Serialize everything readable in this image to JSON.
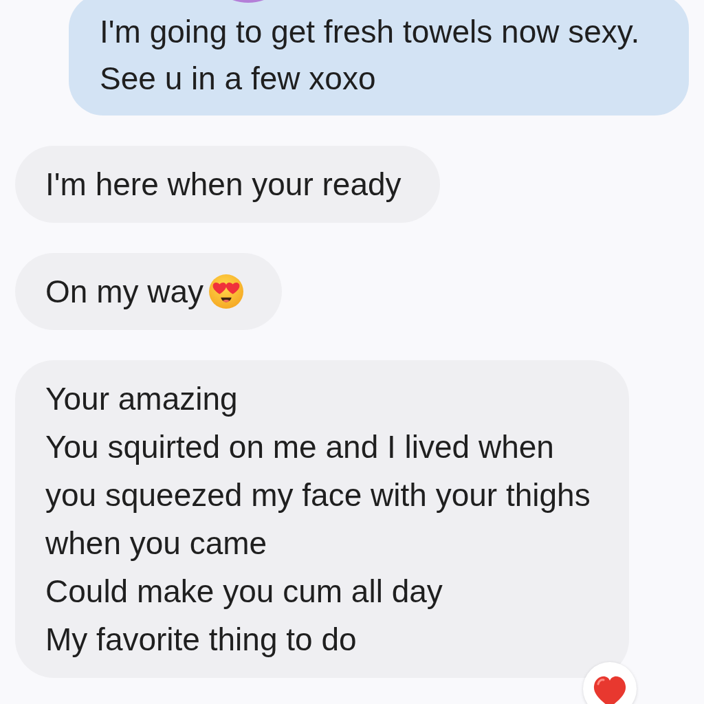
{
  "messages": [
    {
      "kind": "sent",
      "text": "I'm going to get fresh towels now sexy.\nSee u in a few xoxo"
    },
    {
      "kind": "received",
      "text": "I'm here when your ready"
    },
    {
      "kind": "received",
      "text": "On my way",
      "emoji": true
    },
    {
      "kind": "received",
      "text": "Your amazing\nYou squirted on me and I lived when\nyou squeezed my face with your thighs\nwhen you came\nCould make you cum all day\nMy favorite thing to do",
      "reaction": true
    }
  ]
}
